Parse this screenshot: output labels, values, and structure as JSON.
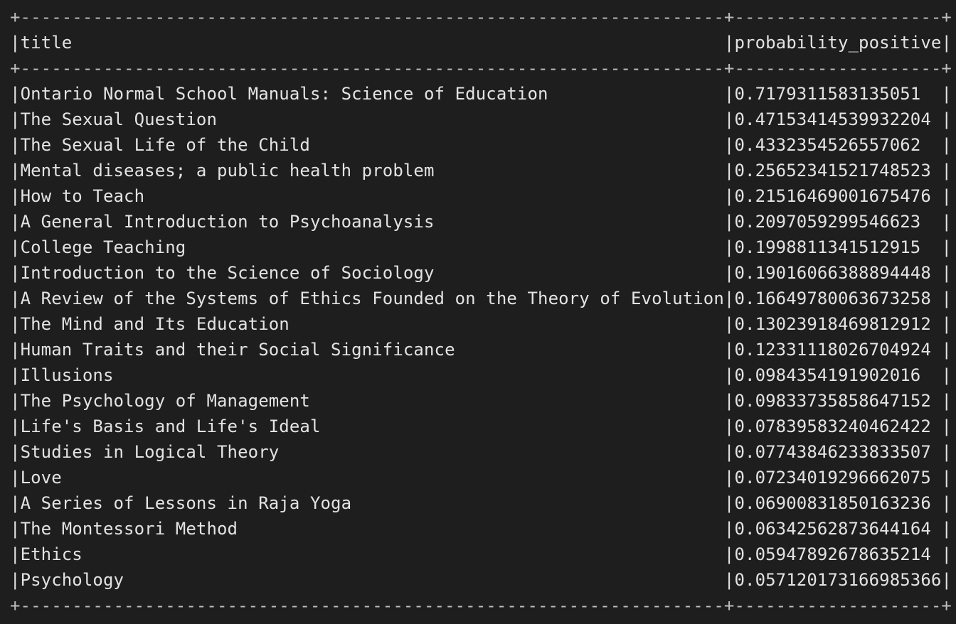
{
  "table": {
    "header": {
      "title": "title",
      "value": "probability_positive"
    },
    "rows": [
      {
        "title": "Ontario Normal School Manuals: Science of Education",
        "value": "0.7179311583135051"
      },
      {
        "title": "The Sexual Question",
        "value": "0.47153414539932204"
      },
      {
        "title": "The Sexual Life of the Child",
        "value": "0.4332354526557062"
      },
      {
        "title": "Mental diseases; a public health problem",
        "value": "0.25652341521748523"
      },
      {
        "title": "How to Teach",
        "value": "0.21516469001675476"
      },
      {
        "title": "A General Introduction to Psychoanalysis",
        "value": "0.2097059299546623"
      },
      {
        "title": "College Teaching",
        "value": "0.1998811341512915"
      },
      {
        "title": "Introduction to the Science of Sociology",
        "value": "0.19016066388894448"
      },
      {
        "title": "A Review of the Systems of Ethics Founded on the Theory of Evolution",
        "value": "0.16649780063673258"
      },
      {
        "title": "The Mind and Its Education",
        "value": "0.13023918469812912"
      },
      {
        "title": "Human Traits and their Social Significance",
        "value": "0.12331118026704924"
      },
      {
        "title": "Illusions",
        "value": "0.0984354191902016"
      },
      {
        "title": "The Psychology of Management",
        "value": "0.09833735858647152"
      },
      {
        "title": "Life's Basis and Life's Ideal",
        "value": "0.07839583240462422"
      },
      {
        "title": "Studies in Logical Theory",
        "value": "0.07743846233833507"
      },
      {
        "title": "Love",
        "value": "0.07234019296662075"
      },
      {
        "title": "A Series of Lessons in Raja Yoga",
        "value": "0.06900831850163236"
      },
      {
        "title": "The Montessori Method",
        "value": "0.06342562873644164"
      },
      {
        "title": "Ethics",
        "value": "0.05947892678635214"
      },
      {
        "title": "Psychology",
        "value": "0.057120173166985366"
      }
    ]
  }
}
